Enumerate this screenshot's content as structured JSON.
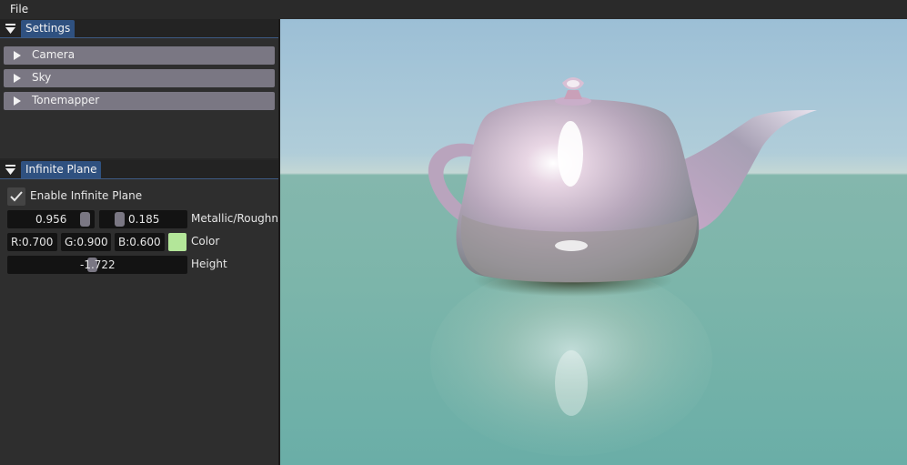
{
  "menubar": {
    "file": "File"
  },
  "settings_window": {
    "title": "Settings",
    "sections": [
      {
        "label": "Camera"
      },
      {
        "label": "Sky"
      },
      {
        "label": "Tonemapper"
      }
    ]
  },
  "plane_window": {
    "title": "Infinite Plane",
    "enable": {
      "label": "Enable Infinite Plane",
      "checked": true
    },
    "metallic": {
      "value": "0.956",
      "fraction": 0.956
    },
    "roughness": {
      "value": "0.185",
      "fraction": 0.185
    },
    "metallic_roughness_label": "Metallic/Roughness",
    "color": {
      "r": "R:0.700",
      "g": "G:0.900",
      "b": "B:0.600",
      "label": "Color",
      "swatch": "#b3e699"
    },
    "height": {
      "value": "-1.722",
      "label": "Height"
    }
  },
  "viewport": {
    "sky_color": "#a7c7d8",
    "ground_color": "#7cb5aa",
    "object": "chrome teapot"
  },
  "colors": {
    "accent": "#2f5180",
    "header": "#7a7783",
    "panel": "#2e2e2e",
    "field": "#131313"
  }
}
